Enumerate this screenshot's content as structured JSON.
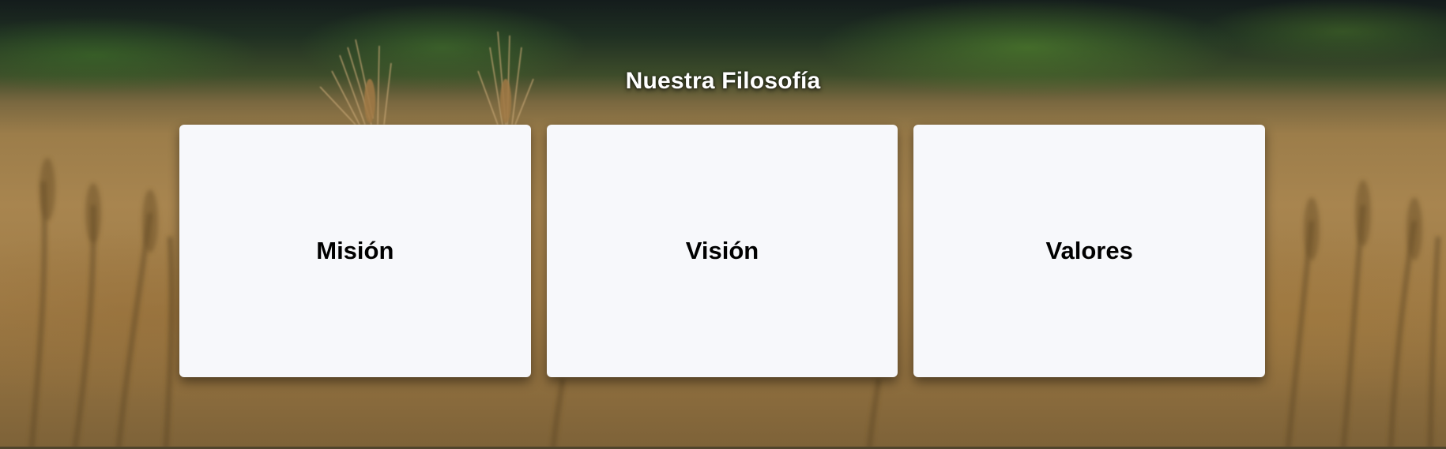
{
  "section": {
    "title": "Nuestra Filosofía"
  },
  "cards": [
    {
      "title": "Misión"
    },
    {
      "title": "Visión"
    },
    {
      "title": "Valores"
    }
  ],
  "background": {
    "image": "wheat-field",
    "colors": {
      "sky_dark": "#141c1c",
      "trees": "#3d4c2a",
      "wheat": "#a8854f"
    }
  },
  "colors": {
    "card_bg": "#f7f8fb",
    "card_text": "#000000",
    "title_text": "#ffffff"
  }
}
